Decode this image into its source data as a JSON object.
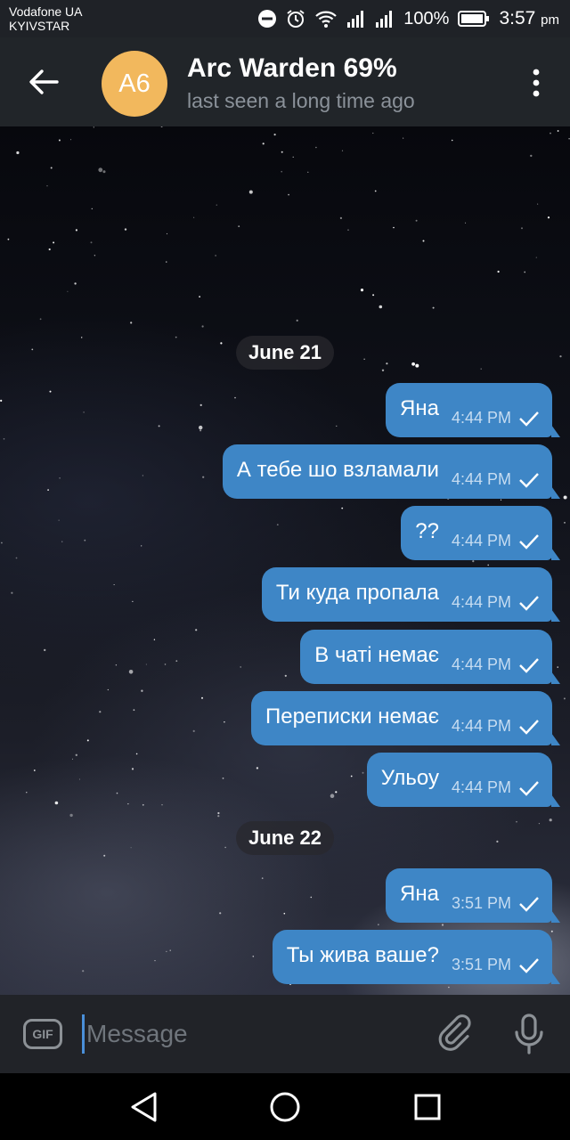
{
  "status_bar": {
    "carrier_1": "Vodafone UA",
    "carrier_2": "KYIVSTAR",
    "battery": "100%",
    "time": "3:57",
    "time_suffix": "pm",
    "icons": [
      "dnd-icon",
      "alarm-icon",
      "wifi-icon",
      "signal-icon",
      "signal-icon",
      "battery-icon"
    ]
  },
  "header": {
    "avatar_initials": "A6",
    "title": "Arc Warden 69%",
    "subtitle": "last seen a long time ago",
    "avatar_color": "#f2b85d"
  },
  "chat": {
    "dates": [
      "June 21",
      "June 22"
    ],
    "messages": [
      {
        "text": "Яна",
        "time": "4:44 PM",
        "status": "sent"
      },
      {
        "text": "А тебе шо взламали",
        "time": "4:44 PM",
        "status": "sent"
      },
      {
        "text": "??",
        "time": "4:44 PM",
        "status": "sent"
      },
      {
        "text": "Ти куда пропала",
        "time": "4:44 PM",
        "status": "sent"
      },
      {
        "text": "В чаті немає",
        "time": "4:44 PM",
        "status": "sent"
      },
      {
        "text": "Переписки немає",
        "time": "4:44 PM",
        "status": "sent"
      },
      {
        "text": "Ульоу",
        "time": "4:44 PM",
        "status": "sent"
      },
      {
        "text": "Яна",
        "time": "3:51 PM",
        "status": "sent"
      },
      {
        "text": "Ты жива ваше?",
        "time": "3:51 PM",
        "status": "sent"
      }
    ],
    "bubble_color": "#3e86c6"
  },
  "input": {
    "gif_label": "GIF",
    "placeholder": "Message"
  }
}
